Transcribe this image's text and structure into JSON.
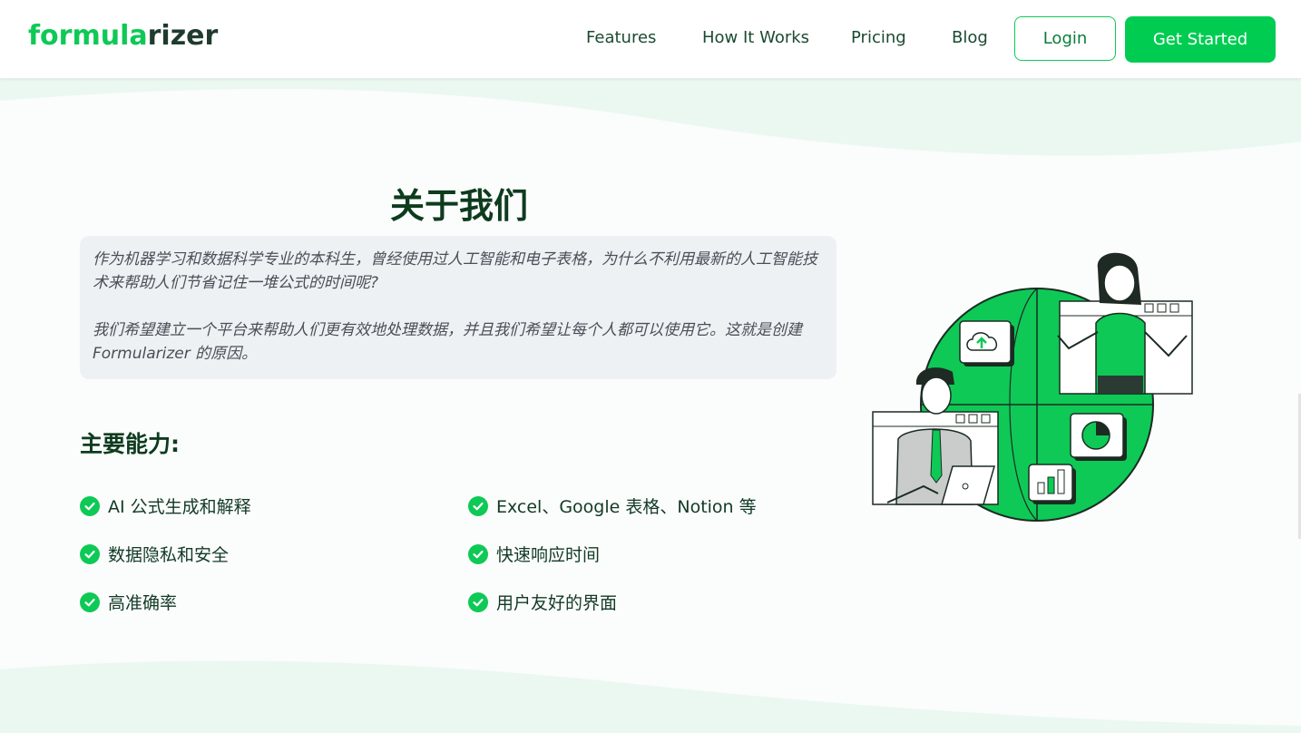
{
  "nav": {
    "logo_part1": "formula",
    "logo_part2": "rizer",
    "links": [
      "Features",
      "How It Works",
      "Pricing",
      "Blog"
    ],
    "login_label": "Login",
    "cta_label": "Get Started"
  },
  "about": {
    "title": "关于我们",
    "paragraph1": "作为机器学习和数据科学专业的本科生，曾经使用过人工智能和电子表格，为什么不利用最新的人工智能技术来帮助人们节省记住一堆公式的时间呢?",
    "paragraph2": "我们希望建立一个平台来帮助人们更有效地处理数据，并且我们希望让每个人都可以使用它。这就是创建 Formularizer 的原因。"
  },
  "capabilities": {
    "heading": "主要能力:",
    "items": [
      "AI 公式生成和解释",
      "Excel、Google 表格、Notion 等",
      "数据隐私和安全",
      "快速响应时间",
      "高准确率",
      "用户友好的界面"
    ]
  },
  "colors": {
    "brand": "#0ec956",
    "heading": "#0d3b1e",
    "wave": "#eaf8f1"
  },
  "icons": [
    "check-circle-icon",
    "cloud-upload-icon",
    "pie-chart-icon",
    "bar-chart-icon"
  ]
}
